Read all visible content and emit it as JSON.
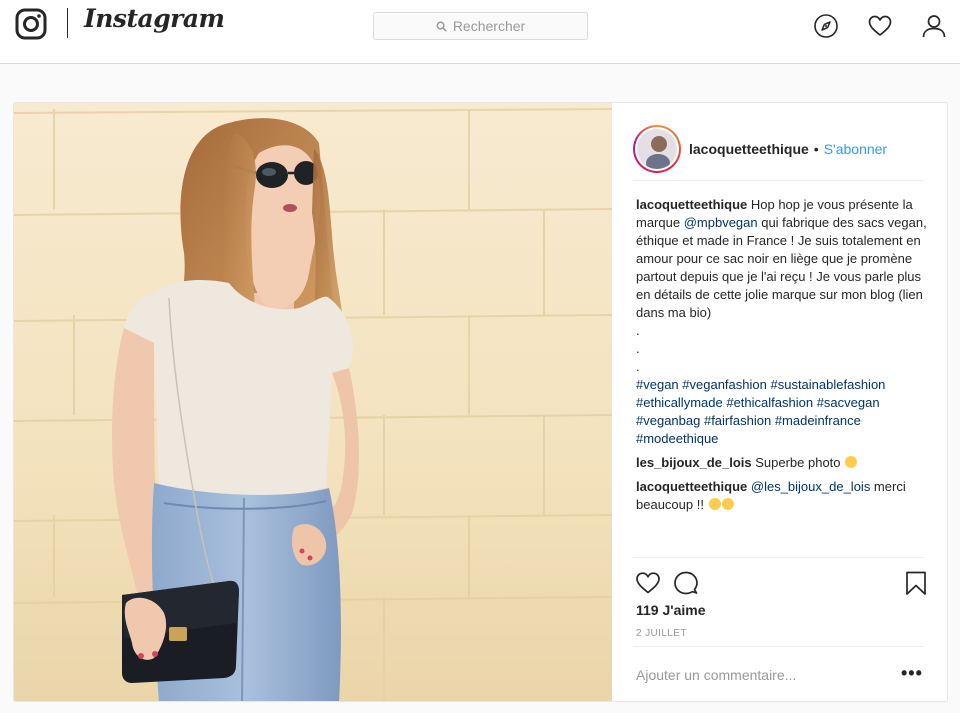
{
  "nav": {
    "logo_text": "Instagram",
    "search_placeholder": "Rechercher",
    "icons": [
      "camera-icon",
      "search-icon",
      "compass-icon",
      "heart-icon",
      "user-icon"
    ]
  },
  "post": {
    "username": "lacoquetteethique",
    "separator": "•",
    "follow_label": "S'abonner",
    "caption": {
      "username": "lacoquetteethique",
      "text_1": " Hop hop je vous présente la marque ",
      "mention": "@mpbvegan",
      "text_2": " qui fabrique des sacs vegan, éthique et made in France ! Je suis totalement en amour pour ce sac noir en liège que je promène partout depuis que je l'ai reçu ! Je vous parle plus en détails de cette jolie marque sur mon blog (lien dans ma bio)",
      "dot1": ".",
      "dot2": ".",
      "dot3": ".",
      "hashtags": [
        "#vegan",
        "#veganfashion",
        "#sustainablefashion",
        "#ethicallymade",
        "#ethicalfashion",
        "#sacvegan",
        "#veganbag",
        "#fairfashion",
        "#madeinfrance",
        "#modeethique"
      ]
    },
    "comments": [
      {
        "username": "les_bijoux_de_lois",
        "text": " Superbe photo "
      },
      {
        "username": "lacoquetteethique",
        "mention": "@les_bijoux_de_lois",
        "text": " merci beaucoup !! "
      }
    ],
    "likes": "119 J'aime",
    "date": "2 JUILLET",
    "add_comment_placeholder": "Ajouter un commentaire...",
    "more_label": "•••"
  },
  "colors": {
    "link": "#3897f0",
    "hashtag": "#003569",
    "border": "#dbdbdb"
  }
}
